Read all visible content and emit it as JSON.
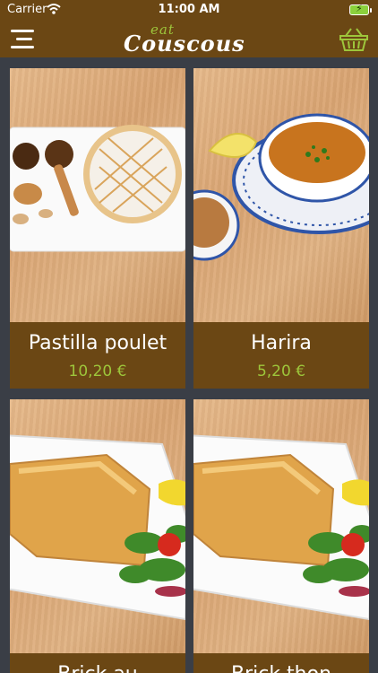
{
  "status_bar": {
    "carrier": "Carrier",
    "time": "11:00 AM"
  },
  "header": {
    "logo_top": "eat",
    "logo_main": "Couscous",
    "menu_icon": "hamburger-menu-icon",
    "cart_icon": "basket-icon"
  },
  "colors": {
    "bar": "#6b4714",
    "background": "#3a3e46",
    "price": "#9dc63b"
  },
  "products": [
    {
      "name": "Pastilla poulet",
      "price": "10,20 €"
    },
    {
      "name": "Harira",
      "price": "5,20 €"
    },
    {
      "name": "Brick au",
      "price": ""
    },
    {
      "name": "Brick thon",
      "price": ""
    }
  ]
}
